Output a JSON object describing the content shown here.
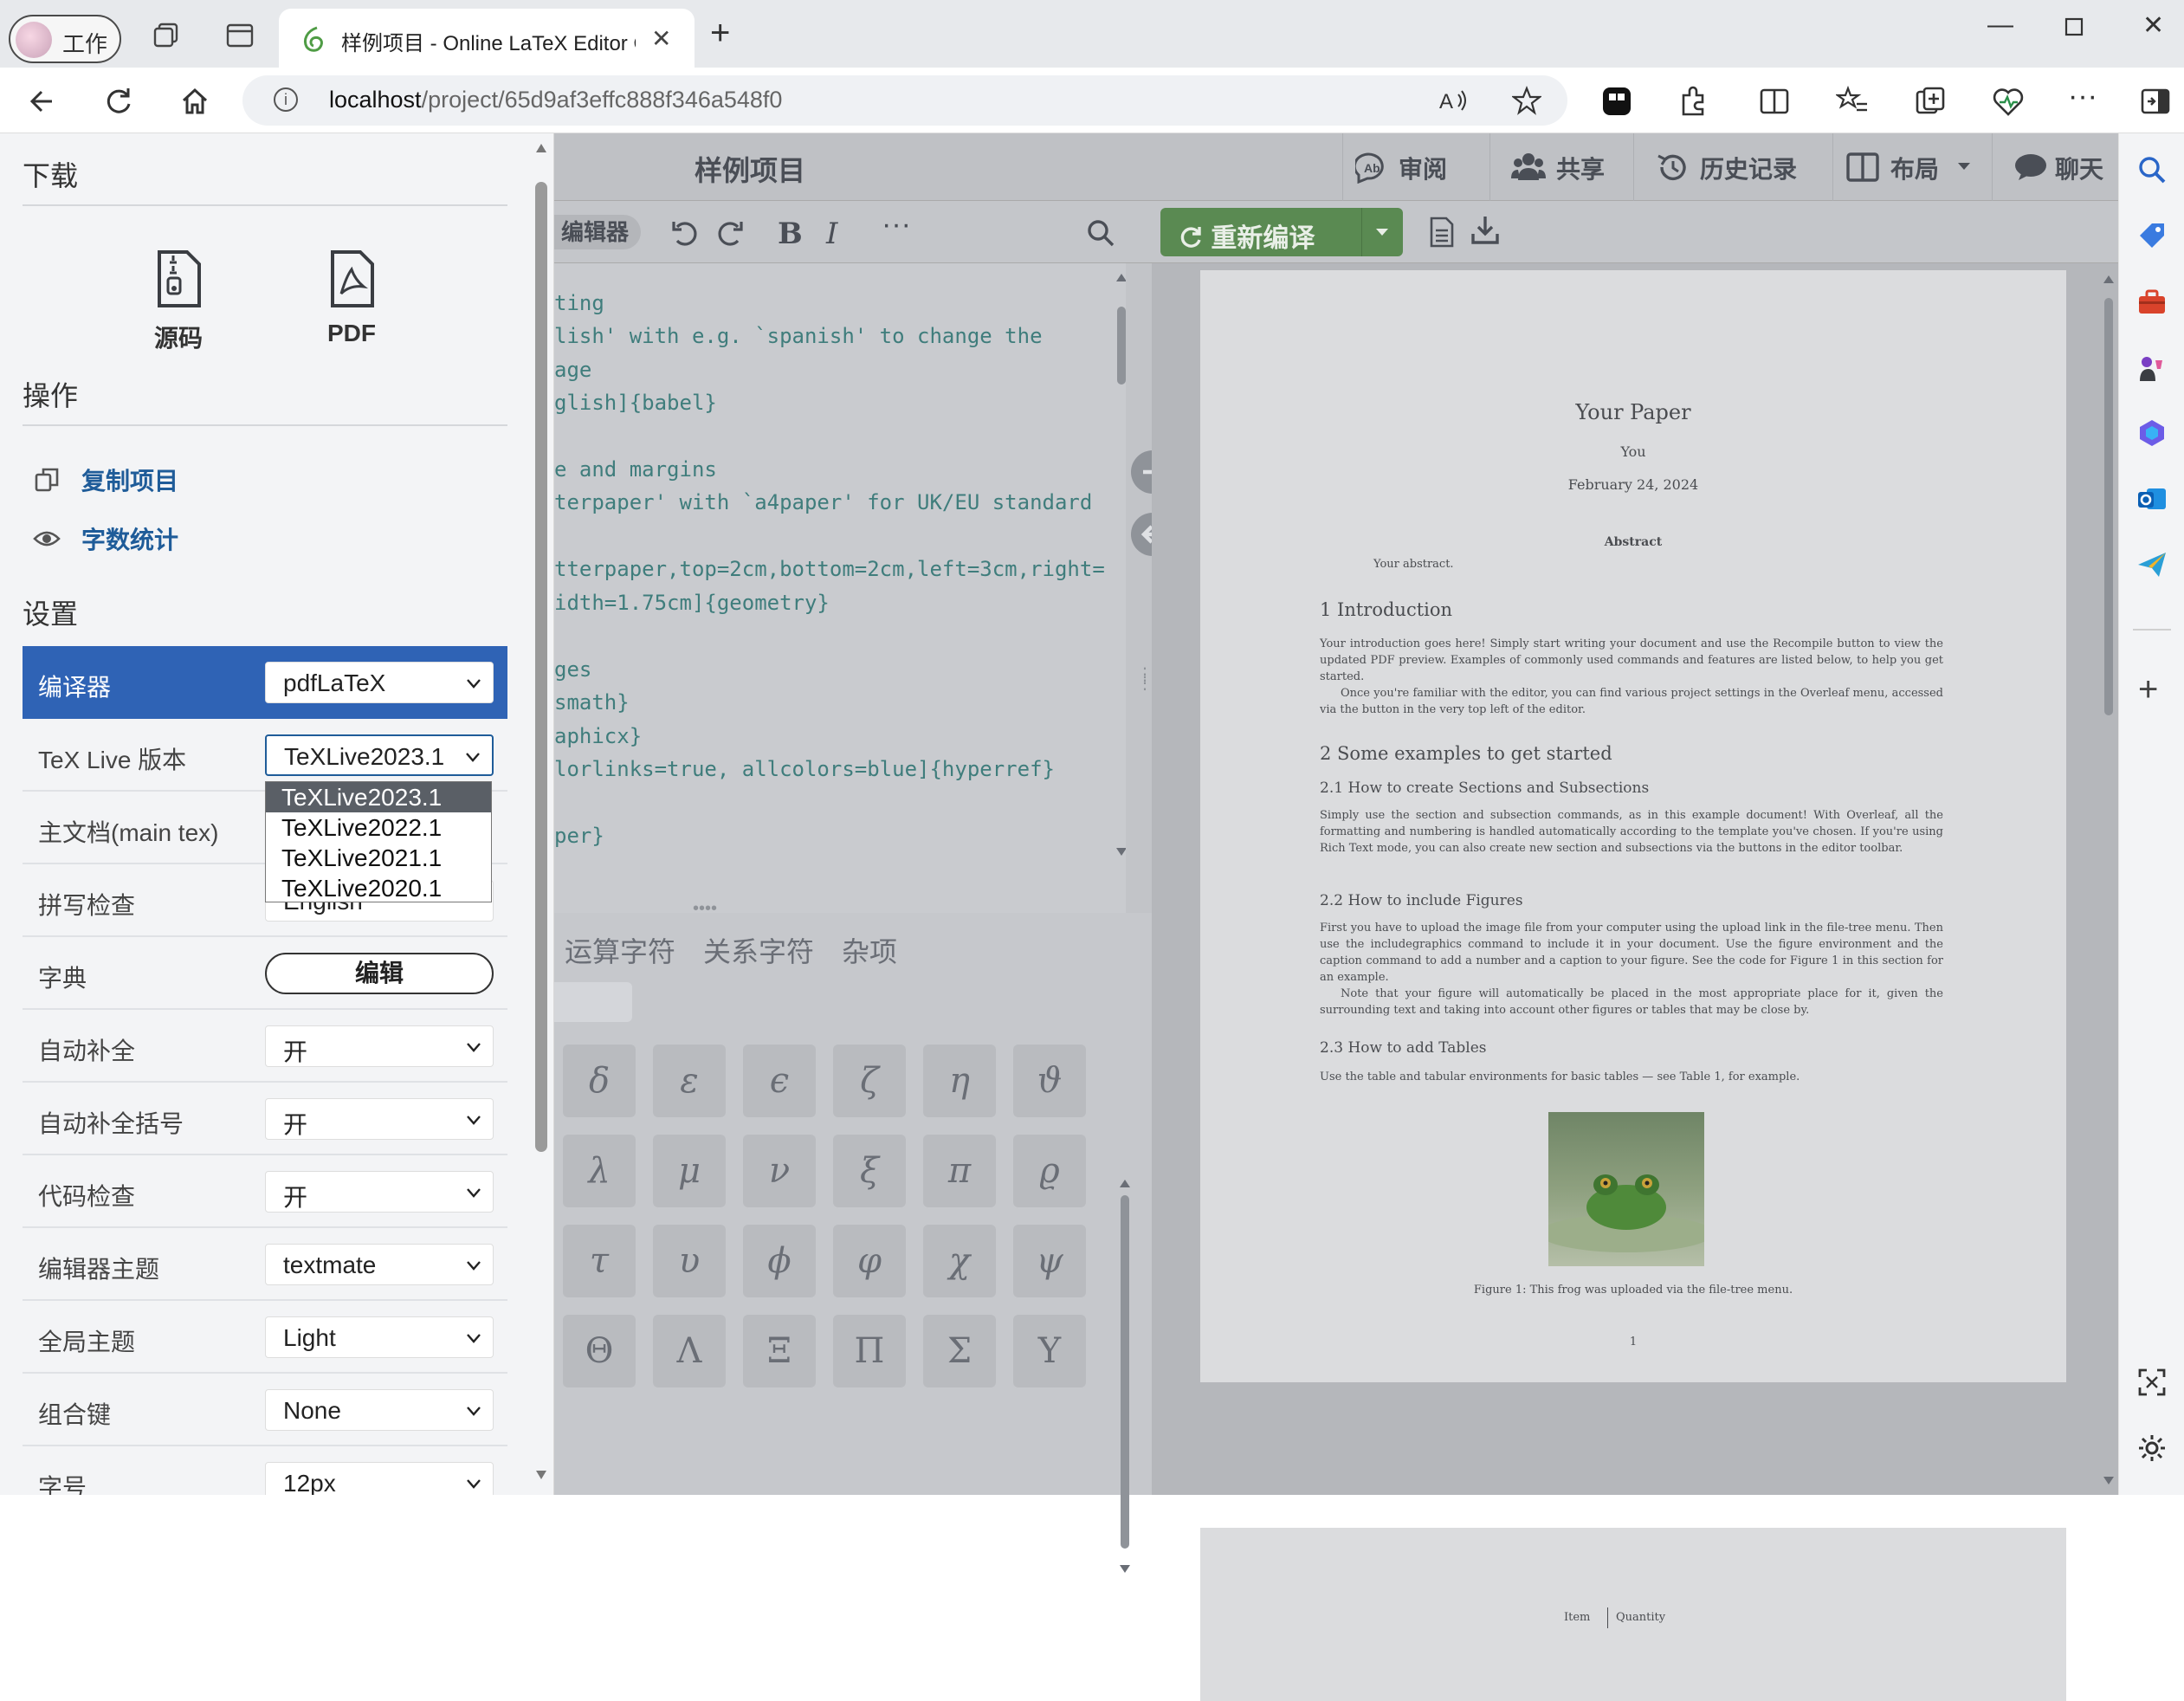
{
  "browser": {
    "profile_label": "工作",
    "tab_title": "样例项目 - Online LaTeX Editor O",
    "url_host": "localhost",
    "url_path": "/project/65d9af3effc888f346a548f0"
  },
  "left_panel": {
    "download_heading": "下载",
    "downloads": [
      {
        "label": "源码"
      },
      {
        "label": "PDF"
      }
    ],
    "actions_heading": "操作",
    "actions": [
      {
        "label": "复制项目"
      },
      {
        "label": "字数统计"
      }
    ],
    "settings_heading": "设置",
    "settings": [
      {
        "label": "编译器",
        "value": "pdfLaTeX"
      },
      {
        "label": "TeX Live 版本",
        "value": "TeXLive2023.1"
      },
      {
        "label": "主文档(main tex)",
        "value": ""
      },
      {
        "label": "拼写检查",
        "value": "English"
      },
      {
        "label": "字典",
        "value": "编辑"
      },
      {
        "label": "自动补全",
        "value": "开"
      },
      {
        "label": "自动补全括号",
        "value": "开"
      },
      {
        "label": "代码检查",
        "value": "开"
      },
      {
        "label": "编辑器主题",
        "value": "textmate"
      },
      {
        "label": "全局主题",
        "value": "Light"
      },
      {
        "label": "组合键",
        "value": "None"
      },
      {
        "label": "字号",
        "value": "12px"
      }
    ],
    "texlive_options": [
      "TeXLive2023.1",
      "TeXLive2022.1",
      "TeXLive2021.1",
      "TeXLive2020.1"
    ]
  },
  "ide": {
    "project_name": "样例项目",
    "top_buttons": [
      {
        "label": "审阅",
        "icon": "review-icon"
      },
      {
        "label": "共享",
        "icon": "share-icon"
      },
      {
        "label": "历史记录",
        "icon": "history-icon"
      },
      {
        "label": "布局",
        "icon": "layout-icon"
      },
      {
        "label": "聊天",
        "icon": "chat-icon"
      }
    ],
    "editor_mode": "编辑器",
    "recompile_label": "重新编译",
    "code_lines": [
      {
        "text": "ting"
      },
      {
        "text": "lish' with e.g. `spanish' to change the"
      },
      {
        "text": "age"
      },
      {
        "text": "glish]{babel}"
      },
      {
        "text": ""
      },
      {
        "text": "e and margins"
      },
      {
        "text": "terpaper' with `a4paper' for UK/EU standard"
      },
      {
        "text": ""
      },
      {
        "text": "tterpaper,top=2cm,bottom=2cm,left=3cm,right="
      },
      {
        "text": "idth=1.75cm]{geometry}"
      },
      {
        "text": ""
      },
      {
        "text": "ges"
      },
      {
        "text": "smath}"
      },
      {
        "text": "aphicx}"
      },
      {
        "text": "lorlinks=true, allcolors=blue]{hyperref}"
      },
      {
        "text": ""
      },
      {
        "text": "per}"
      }
    ],
    "symbol_tabs": [
      "运算字符",
      "关系字符",
      "杂项"
    ],
    "symbols": [
      "δ",
      "ε",
      "ϵ",
      "ζ",
      "η",
      "ϑ",
      "λ",
      "μ",
      "ν",
      "ξ",
      "π",
      "ϱ",
      "τ",
      "υ",
      "ϕ",
      "φ",
      "χ",
      "ψ",
      "Θ",
      "Λ",
      "Ξ",
      "Π",
      "Σ",
      "Υ"
    ]
  },
  "pdf": {
    "title": "Your Paper",
    "author": "You",
    "date": "February 24, 2024",
    "abstract_heading": "Abstract",
    "abstract": "Your abstract.",
    "s1": "1    Introduction",
    "p1": "Your introduction goes here! Simply start writing your document and use the Recompile button to view the updated PDF preview. Examples of commonly used commands and features are listed below, to help you get started.",
    "p1b": "Once you're familiar with the editor, you can find various project settings in the Overleaf menu, accessed via the button in the very top left of the editor.",
    "s2": "2    Some examples to get started",
    "s21": "2.1    How to create Sections and Subsections",
    "p21": "Simply use the section and subsection commands, as in this example document! With Overleaf, all the formatting and numbering is handled automatically according to the template you've chosen. If you're using Rich Text mode, you can also create new section and subsections via the buttons in the editor toolbar.",
    "s22": "2.2    How to include Figures",
    "p22": "First you have to upload the image file from your computer using the upload link in the file-tree menu. Then use the includegraphics command to include it in your document. Use the figure environment and the caption command to add a number and a caption to your figure. See the code for Figure 1 in this section for an example.",
    "p22b": "Note that your figure will automatically be placed in the most appropriate place for it, given the surrounding text and taking into account other figures or tables that may be close by.",
    "s23": "2.3    How to add Tables",
    "p23": "Use the table and tabular environments for basic tables — see Table 1, for example.",
    "caption": "Figure 1: This frog was uploaded via the file-tree menu.",
    "page_number": "1",
    "table_head_item": "Item",
    "table_head_qty": "Quantity"
  },
  "colors": {
    "accent_blue": "#2f63b5",
    "link_blue": "#1f5c99",
    "recompile_green": "#5a8a52"
  }
}
